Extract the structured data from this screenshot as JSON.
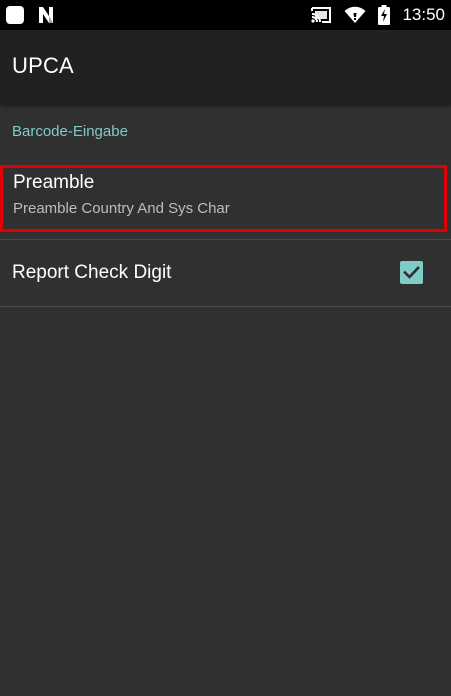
{
  "status_bar": {
    "time": "13:50",
    "icons": [
      "notification-square-icon",
      "n-logo-icon",
      "cast-icon",
      "wifi-icon",
      "battery-charging-icon"
    ]
  },
  "app_bar": {
    "title": "UPCA"
  },
  "preferences": {
    "category": "Barcode-Eingabe",
    "preamble": {
      "title": "Preamble",
      "summary": "Preamble Country And Sys Char",
      "highlighted": true
    },
    "report_check_digit": {
      "title": "Report Check Digit",
      "checked": true
    }
  },
  "colors": {
    "accent": "#80cbc4",
    "background": "#303030",
    "app_bar": "#212121",
    "highlight_border": "#e00000"
  }
}
